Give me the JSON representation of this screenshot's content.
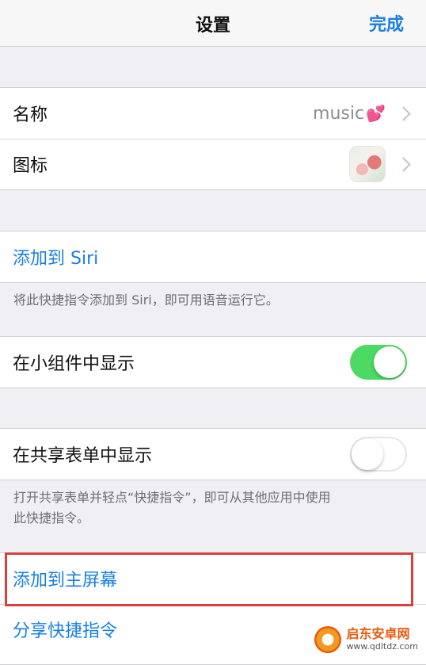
{
  "navbar": {
    "title": "设置",
    "done_label": "完成"
  },
  "name_row": {
    "label": "名称",
    "value": "music",
    "emoji": "💕"
  },
  "icon_row": {
    "label": "图标"
  },
  "siri": {
    "button_label": "添加到 Siri",
    "footer": "将此快捷指令添加到 Siri，即可用语音运行它。"
  },
  "widget_row": {
    "label": "在小组件中显示",
    "enabled": true
  },
  "share_sheet_row": {
    "label": "在共享表单中显示",
    "enabled": false,
    "footer_line1": "打开共享表单并轻点“快捷指令”，即可从其他应用中使用",
    "footer_line2": "此快捷指令。"
  },
  "actions": {
    "add_home_label": "添加到主屏幕",
    "share_label": "分享快捷指令"
  },
  "watermark": {
    "title": "启东安卓网",
    "url": "www.qdltdz.com"
  },
  "colors": {
    "accent": "#1a7fe0",
    "toggle_on": "#4cd964",
    "highlight": "#d9403c"
  }
}
